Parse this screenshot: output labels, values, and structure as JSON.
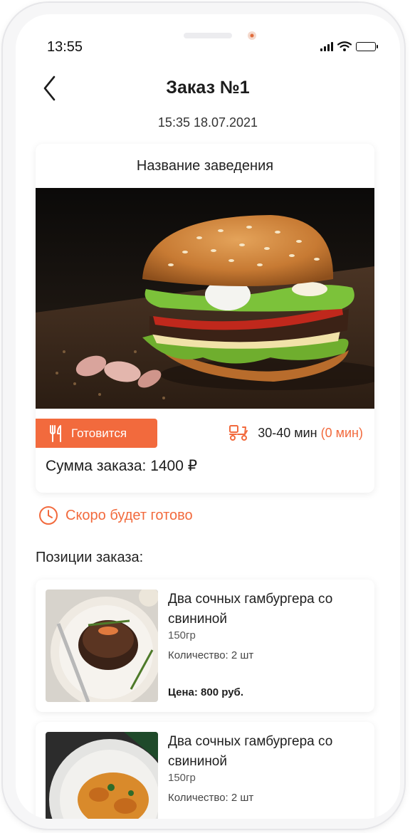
{
  "status_bar": {
    "time": "13:55"
  },
  "header": {
    "title": "Заказ №1",
    "datetime": "15:35 18.07.2021"
  },
  "venue": {
    "name": "Название заведения",
    "status_label": "Готовится",
    "delivery_time": "30-40 мин",
    "delivery_extra": "(0 мин)",
    "sum_label": "Сумма заказа: 1400 ₽"
  },
  "notice": {
    "text": "Скоро будет готово"
  },
  "positions": {
    "title": "Позиции заказа:",
    "items": [
      {
        "name": "Два сочных гамбургера со свининой",
        "weight": "150гр",
        "quantity": "Количество: 2 шт",
        "price": "Цена: 800 руб."
      },
      {
        "name": "Два сочных гамбургера со свининой",
        "weight": "150гр",
        "quantity": "Количество: 2 шт"
      }
    ]
  },
  "colors": {
    "accent": "#f26a3d",
    "text": "#1f1f1f"
  },
  "icons": [
    "chevron-left-icon",
    "signal-icon",
    "wifi-icon",
    "battery-icon",
    "fork-knife-icon",
    "delivery-scooter-icon",
    "clock-icon"
  ]
}
